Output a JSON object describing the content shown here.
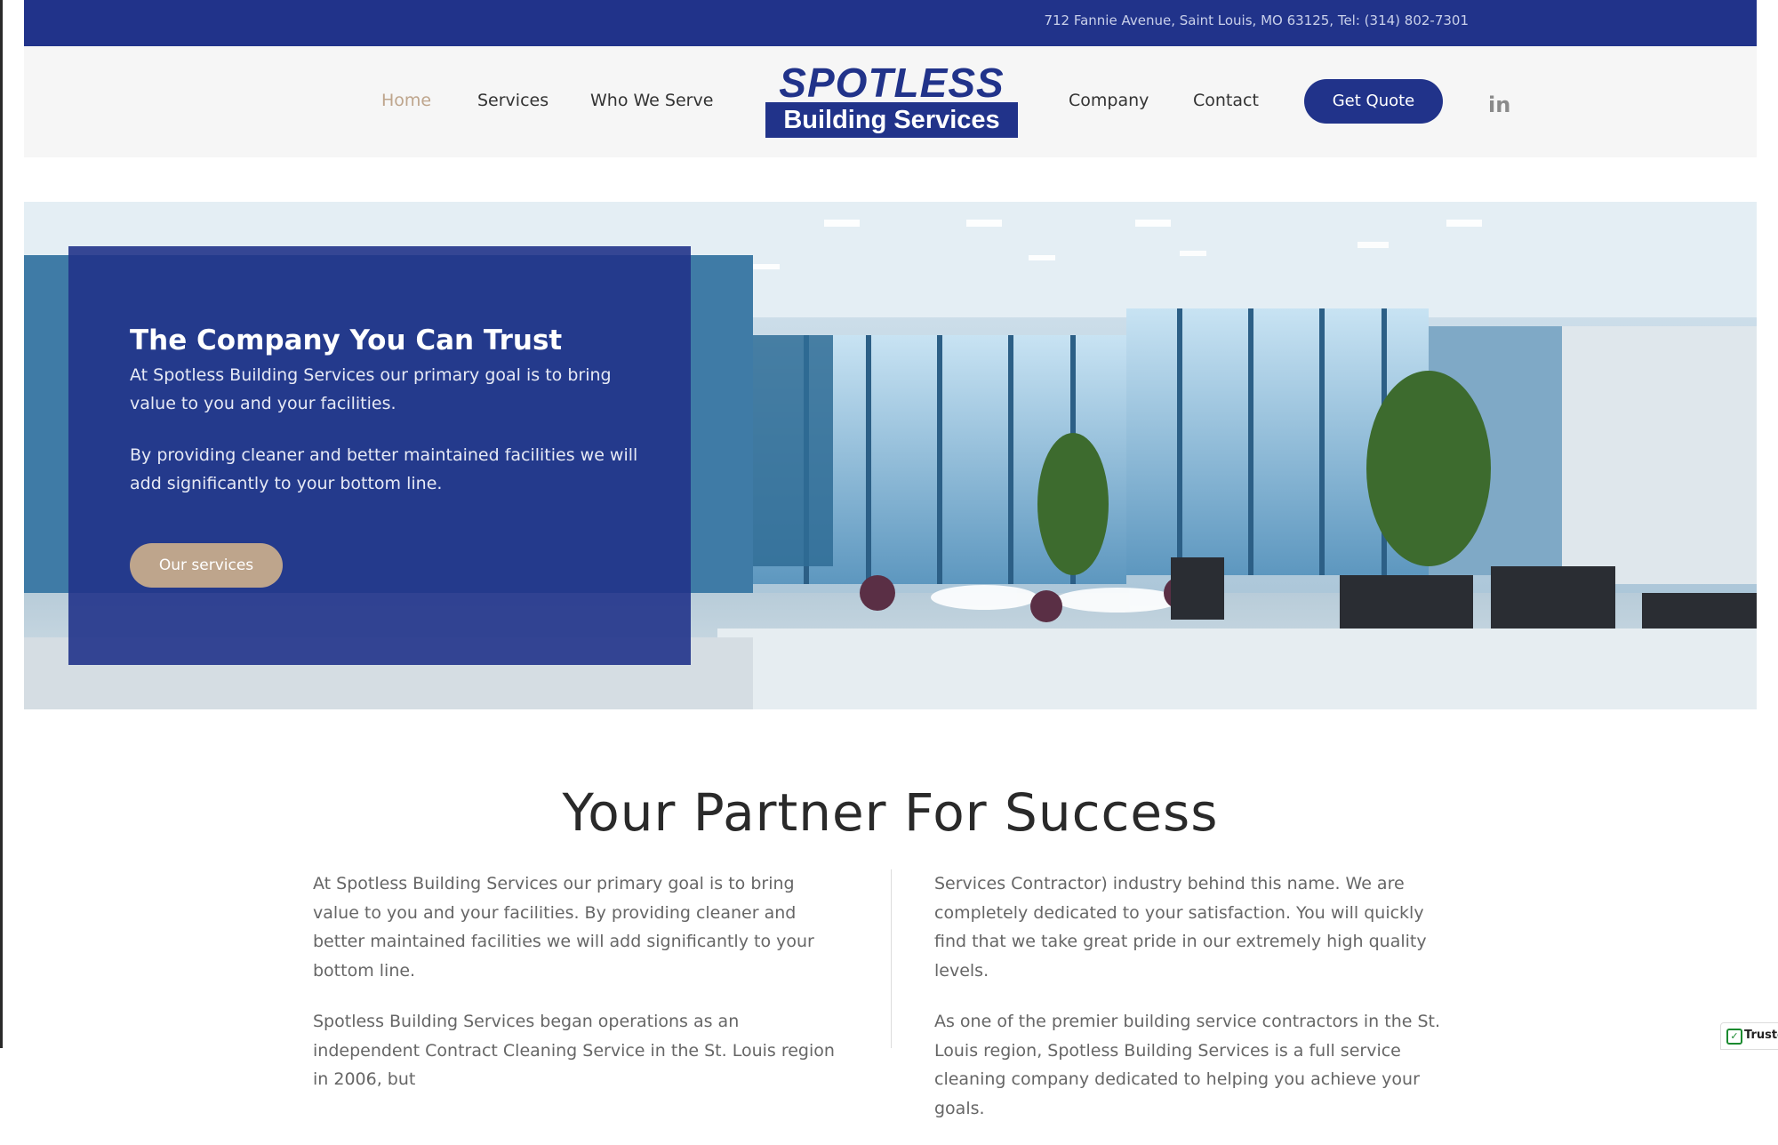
{
  "topbar": {
    "address": "712 Fannie Avenue, Saint Louis, MO 63125, Tel: (314) 802-7301"
  },
  "nav": {
    "home": "Home",
    "services": "Services",
    "who_we_serve": "Who We Serve",
    "company": "Company",
    "contact": "Contact",
    "get_quote": "Get Quote",
    "linkedin_icon": "in"
  },
  "logo": {
    "word": "SPOTLESS",
    "sub": "Building Services"
  },
  "hero": {
    "title": "The Company You Can Trust",
    "p1": "At Spotless Building Services our primary goal is to bring value to you and your facilities.",
    "p2": "By providing cleaner and better maintained facilities we will add significantly to your bottom line.",
    "button": "Our services"
  },
  "partner": {
    "title": "Your Partner For Success",
    "left_p1": "At Spotless Building Services our primary goal is to bring value to you and your facilities. By providing cleaner and better maintained facilities we will add significantly to your bottom line.",
    "left_p2": "Spotless Building Services began operations as an independent Contract Cleaning Service in the St. Louis region in 2006, but",
    "right_p1": "Services Contractor) industry behind this name. We are completely dedicated to your satisfaction. You will quickly find that we take great pride in our extremely high quality levels.",
    "right_p2": "As one of the premier building service contractors in the St. Louis region, Spotless Building Services is a full service cleaning company dedicated to helping you achieve your goals."
  },
  "badge": {
    "text": "Truste"
  },
  "colors": {
    "brand_blue": "#21338a",
    "accent_tan": "#bea58c"
  }
}
